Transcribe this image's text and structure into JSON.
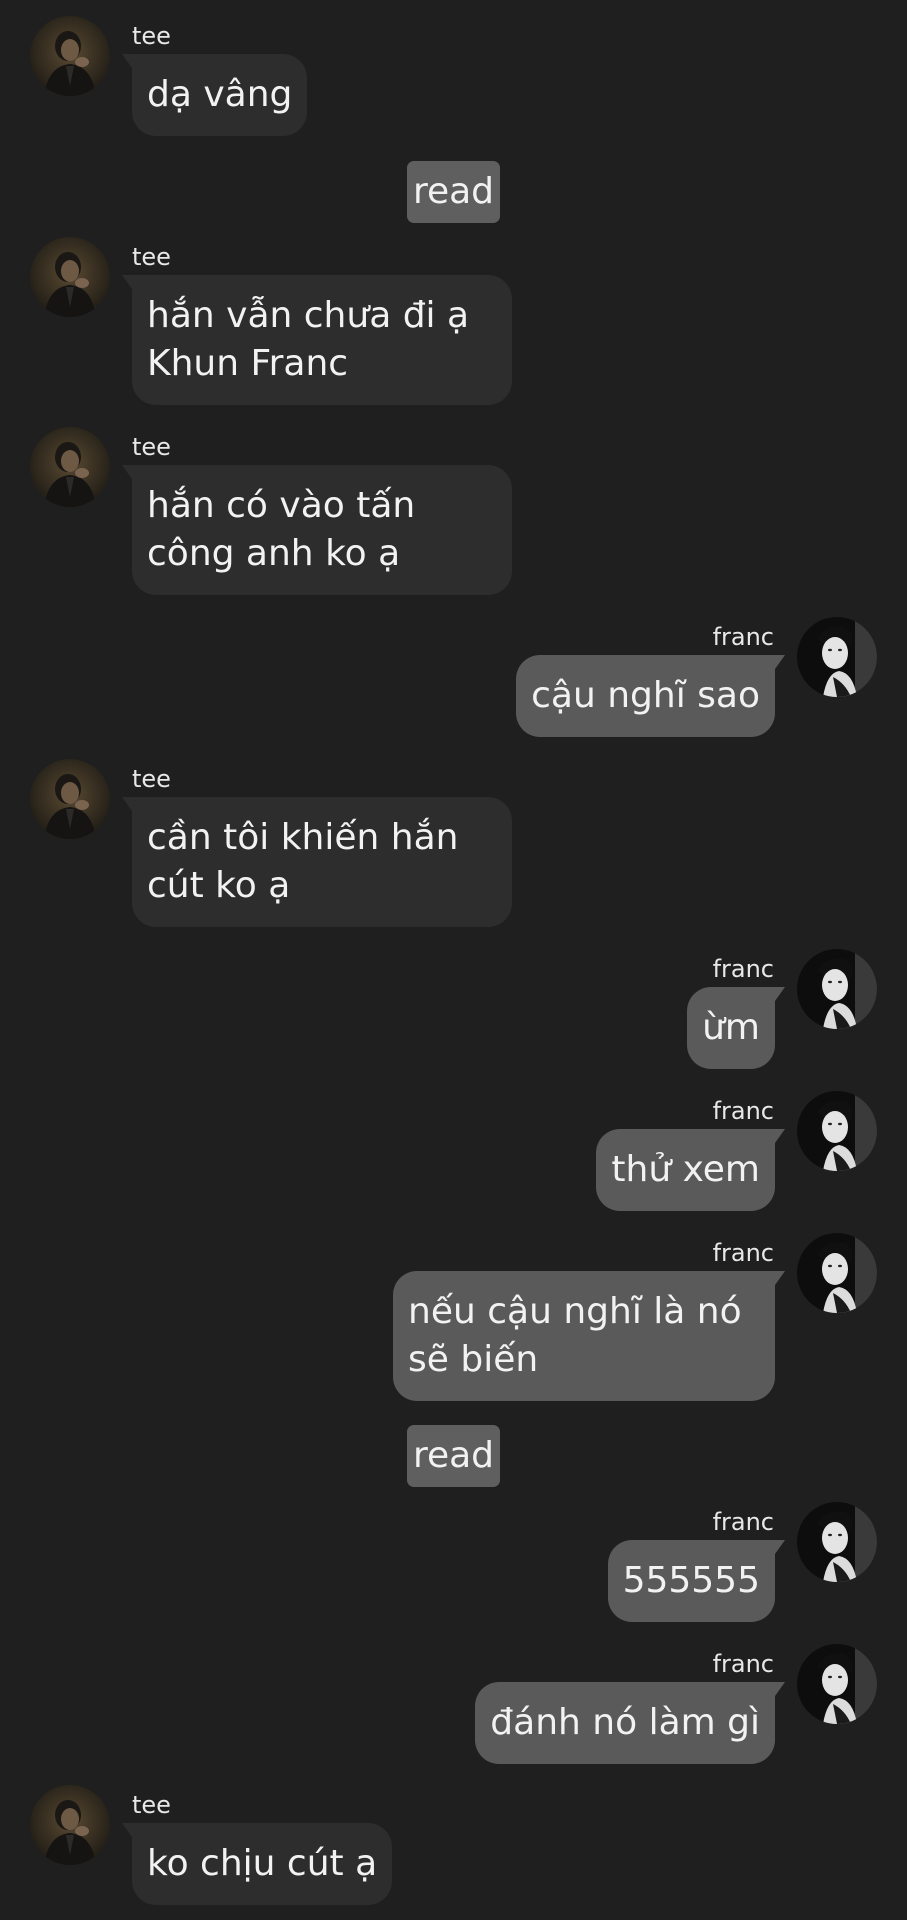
{
  "messages": [
    {
      "sender": "tee",
      "side": "left",
      "text": "dạ vâng"
    },
    {
      "type": "read",
      "label": "read"
    },
    {
      "sender": "tee",
      "side": "left",
      "text": "hắn vẫn chưa đi ạ\nKhun Franc"
    },
    {
      "sender": "tee",
      "side": "left",
      "text": "hắn có vào tấn\ncông anh ko ạ"
    },
    {
      "sender": "franc",
      "side": "right",
      "text": "cậu nghĩ sao"
    },
    {
      "sender": "tee",
      "side": "left",
      "text": "cần tôi khiến hắn\ncút ko ạ"
    },
    {
      "sender": "franc",
      "side": "right",
      "text": "ừm"
    },
    {
      "sender": "franc",
      "side": "right",
      "text": "thử xem"
    },
    {
      "sender": "franc",
      "side": "right",
      "text": "nếu cậu nghĩ là nó\nsẽ biến"
    },
    {
      "type": "read",
      "label": "read"
    },
    {
      "sender": "franc",
      "side": "right",
      "text": "555555"
    },
    {
      "sender": "franc",
      "side": "right",
      "text": "đánh nó làm gì"
    },
    {
      "sender": "tee",
      "side": "left",
      "text": "ko chịu cút ạ"
    }
  ],
  "colors": {
    "background": "#1f1f1f",
    "incoming_bubble": "#2d2d2d",
    "outgoing_bubble": "#5a5a5a",
    "read_badge": "#5f5f5f"
  },
  "icons": {
    "tee_avatar": "avatar-icon",
    "franc_avatar": "avatar-icon"
  }
}
